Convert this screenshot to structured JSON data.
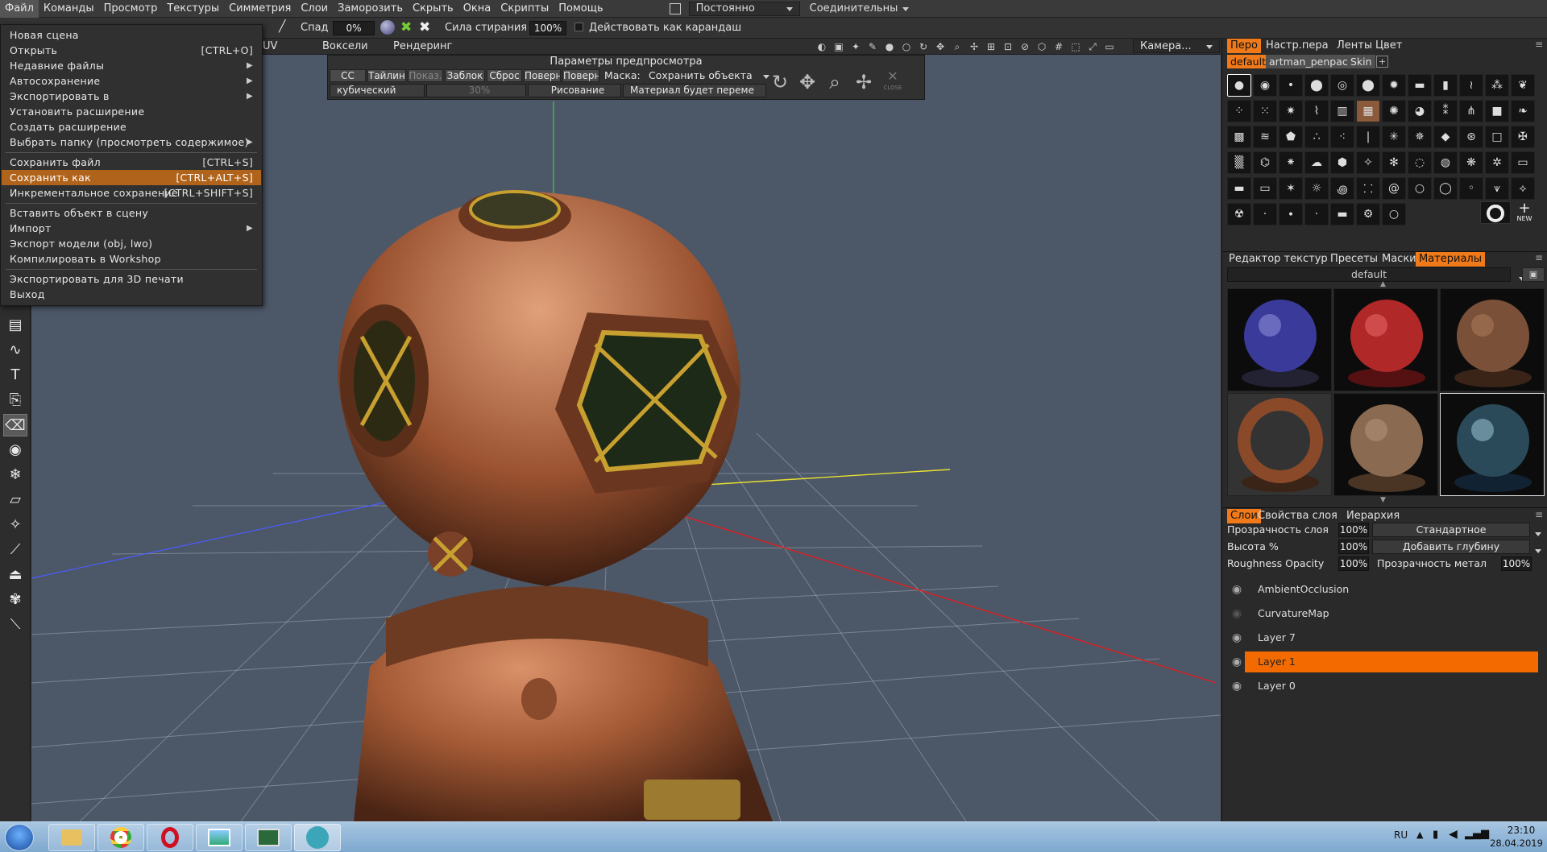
{
  "menubar": {
    "items": [
      "Файл",
      "Команды",
      "Просмотр",
      "Текстуры",
      "Симметрия",
      "Слои",
      "Заморозить",
      "Скрыть",
      "Окна",
      "Скрипты",
      "Помощь"
    ],
    "mode_combo": "Постоянно",
    "connect_combo": "Соединительны"
  },
  "toolbar": {
    "falloff_label": "Спад",
    "falloff_value": "0%",
    "erase_label": "Сила стирания",
    "erase_value": "100%",
    "pencil_label": "Действовать как карандаш"
  },
  "modebar": {
    "tabs": [
      "UV",
      "Воксели",
      "Рендеринг"
    ],
    "camera_combo": "Камера..."
  },
  "file_menu": {
    "items": [
      {
        "label": "Новая сцена",
        "shortcut": ""
      },
      {
        "label": "Открыть",
        "shortcut": "[CTRL+O]"
      },
      {
        "label": "Недавние файлы",
        "shortcut": ""
      },
      {
        "label": "Автосохранение",
        "shortcut": ""
      },
      {
        "label": "Экспортировать в",
        "shortcut": ""
      },
      {
        "label": "Установить расширение",
        "shortcut": ""
      },
      {
        "label": "Создать расширение",
        "shortcut": ""
      },
      {
        "label": "Выбрать папку (просмотреть содержимое)",
        "shortcut": ""
      },
      {
        "label": "Сохранить файл",
        "shortcut": "[CTRL+S]"
      },
      {
        "label": "Сохранить как",
        "shortcut": "[CTRL+ALT+S]"
      },
      {
        "label": "Инкрементальное сохранение",
        "shortcut": "[CTRL+SHIFT+S]"
      },
      {
        "label": "Вставить объект в сцену",
        "shortcut": ""
      },
      {
        "label": "Импорт",
        "shortcut": ""
      },
      {
        "label": "Экспорт модели (obj, lwo)",
        "shortcut": ""
      },
      {
        "label": "Компилировать в Workshop",
        "shortcut": ""
      },
      {
        "label": "Экспортировать для 3D печати",
        "shortcut": ""
      },
      {
        "label": "Выход",
        "shortcut": ""
      }
    ]
  },
  "preview": {
    "title": "Параметры предпросмотра",
    "buttons": [
      "CC",
      "Тайлинг",
      "Показ.",
      "Заблок",
      "Сброс",
      "Поверн",
      "Поверн"
    ],
    "mask_label": "Маска:",
    "mask_value": "Сохранить объекта",
    "interp": "кубический",
    "percent": "30%",
    "draw_mode": "Рисование",
    "material_mode": "Материал будет переме",
    "close_label": "CLOSE"
  },
  "brush_panel": {
    "tabs": [
      "Перо",
      "Настр.пера",
      "Ленты",
      "Цвет"
    ],
    "sets": [
      "default",
      "artman_penpack",
      "Skin"
    ],
    "new_label": "NEW"
  },
  "material_panel": {
    "tabs": [
      "Редактор текстур",
      "Пресеты",
      "Маски",
      "Материалы"
    ],
    "folder": "default"
  },
  "layers_panel": {
    "tabs": [
      "Слои",
      "Свойства слоя",
      "Иерархия"
    ],
    "opacity_label": "Прозрачность слоя",
    "opacity_value": "100%",
    "blend_mode": "Стандартное",
    "height_label": "Высота %",
    "height_value": "100%",
    "depth_mode": "Добавить глубину",
    "rough_label": "Roughness Opacity",
    "rough_value": "100%",
    "metal_label": "Прозрачность метал",
    "metal_value": "100%",
    "layers": [
      "AmbientOcclusion",
      "CurvatureMap",
      "Layer 7",
      "Layer 1",
      "Layer 0"
    ]
  },
  "taskbar": {
    "lang": "RU",
    "time": "23:10",
    "date": "28.04.2019"
  },
  "colors": {
    "accent": "#f07a1a",
    "menu_highlight": "#b0631a",
    "viewport": "#4c5768"
  }
}
